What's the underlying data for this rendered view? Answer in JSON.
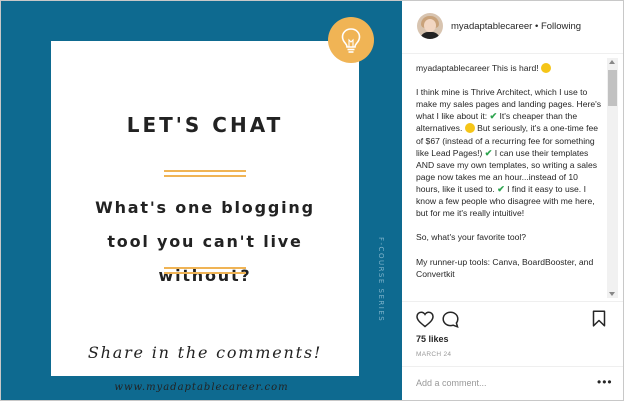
{
  "image": {
    "title": "LET'S CHAT",
    "question_lines": [
      "What's one blogging",
      "tool you can't live",
      "without?"
    ],
    "cta": "Share in the comments!",
    "vertical_text": "F-COURSE SERIES",
    "url": "www.myadaptablecareer.com",
    "colors": {
      "background": "#0e6a90",
      "accent": "#f0b455",
      "card": "#ffffff"
    }
  },
  "post": {
    "header": {
      "username": "myadaptablecareer",
      "separator": " • ",
      "following": "Following"
    },
    "caption": {
      "username": "myadaptablecareer",
      "first": "This is hard!",
      "p1": [
        "I think mine is Thrive Architect, which I use to make my sales pages and landing pages. Here's what I like about it:",
        " It's cheaper than the alternatives.",
        " But seriously, it's a one-time fee of $67 (instead of a recurring fee for something like Lead Pages!)",
        " I can use their templates AND save my own templates, so writing a sales page now takes me an hour...instead of 10 hours, like it used to.",
        " I find it easy to use. I know a few people who disagree with me here, but for me it's really intuitive!"
      ],
      "p2": "So, what's your favorite tool?",
      "p3": "My runner-up tools: Canva, BoardBooster, and Convertkit"
    },
    "likes": "75 likes",
    "date": "MARCH 24",
    "comment_placeholder": "Add a comment...",
    "more": "•••"
  }
}
